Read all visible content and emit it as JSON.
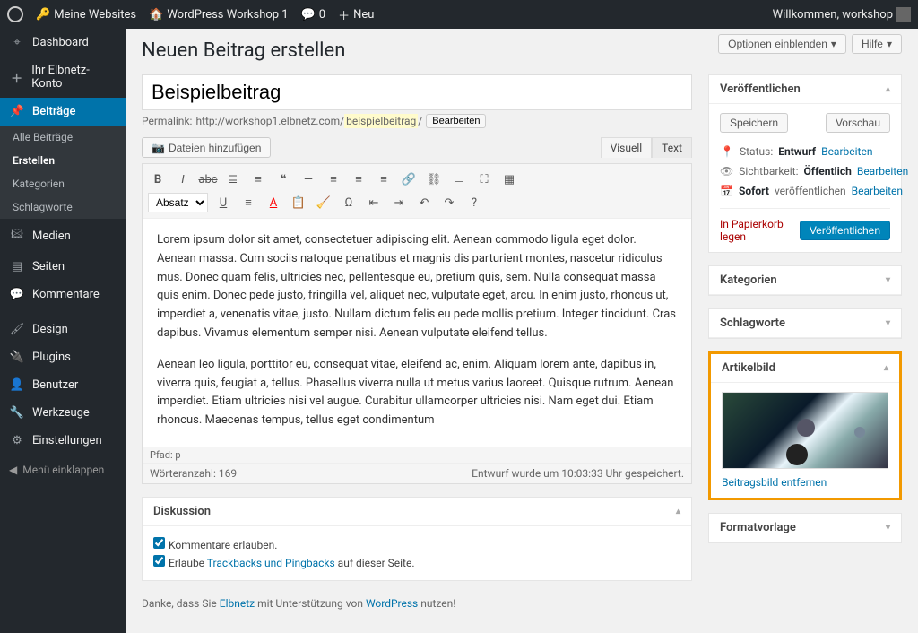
{
  "adminbar": {
    "my_sites": "Meine Websites",
    "site_name": "WordPress Workshop 1",
    "comments_count": "0",
    "new_label": "Neu",
    "welcome": "Willkommen, workshop"
  },
  "sidebar": {
    "dashboard": "Dashboard",
    "elbnetz": "Ihr Elbnetz-Konto",
    "posts": "Beiträge",
    "posts_sub": {
      "all": "Alle Beiträge",
      "create": "Erstellen",
      "categories": "Kategorien",
      "tags": "Schlagworte"
    },
    "media": "Medien",
    "pages": "Seiten",
    "comments": "Kommentare",
    "design": "Design",
    "plugins": "Plugins",
    "users": "Benutzer",
    "tools": "Werkzeuge",
    "settings": "Einstellungen",
    "collapse": "Menü einklappen"
  },
  "screen": {
    "options": "Optionen einblenden",
    "help": "Hilfe"
  },
  "page": {
    "title": "Neuen Beitrag erstellen",
    "post_title": "Beispielbeitrag",
    "permalink_label": "Permalink:",
    "permalink_base": "http://workshop1.elbnetz.com/",
    "permalink_slug": "beispielbeitrag",
    "permalink_edit": "Bearbeiten",
    "add_media": "Dateien hinzufügen",
    "tab_visual": "Visuell",
    "tab_text": "Text",
    "format_dropdown": "Absatz",
    "content_p1": "Lorem ipsum dolor sit amet, consectetuer adipiscing elit. Aenean commodo ligula eget dolor. Aenean massa. Cum sociis natoque penatibus et magnis dis parturient montes, nascetur ridiculus mus. Donec quam felis, ultricies nec, pellentesque eu, pretium quis, sem. Nulla consequat massa quis enim. Donec pede justo, fringilla vel, aliquet nec, vulputate eget, arcu. In enim justo, rhoncus ut, imperdiet a, venenatis vitae, justo. Nullam dictum felis eu pede mollis pretium. Integer tincidunt. Cras dapibus. Vivamus elementum semper nisi. Aenean vulputate eleifend tellus.",
    "content_p2": "Aenean leo ligula, porttitor eu, consequat vitae, eleifend ac, enim. Aliquam lorem ante, dapibus in, viverra quis, feugiat a, tellus. Phasellus viverra nulla ut metus varius laoreet. Quisque rutrum. Aenean imperdiet. Etiam ultricies nisi vel augue. Curabitur ullamcorper ultricies nisi. Nam eget dui. Etiam rhoncus. Maecenas tempus, tellus eget condimentum",
    "path": "Pfad: p",
    "wordcount": "Wörteranzahl: 169",
    "save_msg": "Entwurf wurde um 10:03:33 Uhr gespeichert."
  },
  "publish": {
    "title": "Veröffentlichen",
    "save_draft": "Speichern",
    "preview": "Vorschau",
    "status_label": "Status:",
    "status_value": "Entwurf",
    "visibility_label": "Sichtbarkeit:",
    "visibility_value": "Öffentlich",
    "schedule_label": "Sofort",
    "schedule_suffix": "veröffentlichen",
    "edit": "Bearbeiten",
    "trash": "In Papierkorb legen",
    "publish_btn": "Veröffentlichen"
  },
  "boxes": {
    "categories": "Kategorien",
    "tags": "Schlagworte",
    "featured": "Artikelbild",
    "remove_featured": "Beitragsbild entfernen",
    "format": "Formatvorlage",
    "discussion": "Diskussion",
    "allow_comments": "Kommentare erlauben.",
    "allow_trackbacks_pre": "Erlaube ",
    "allow_trackbacks_link": "Trackbacks und Pingbacks",
    "allow_trackbacks_post": " auf dieser Seite."
  },
  "footer": {
    "pre": "Danke, dass Sie ",
    "elbnetz": "Elbnetz",
    "mid": " mit Unterstützung von ",
    "wp": "WordPress",
    "post": " nutzen!"
  }
}
